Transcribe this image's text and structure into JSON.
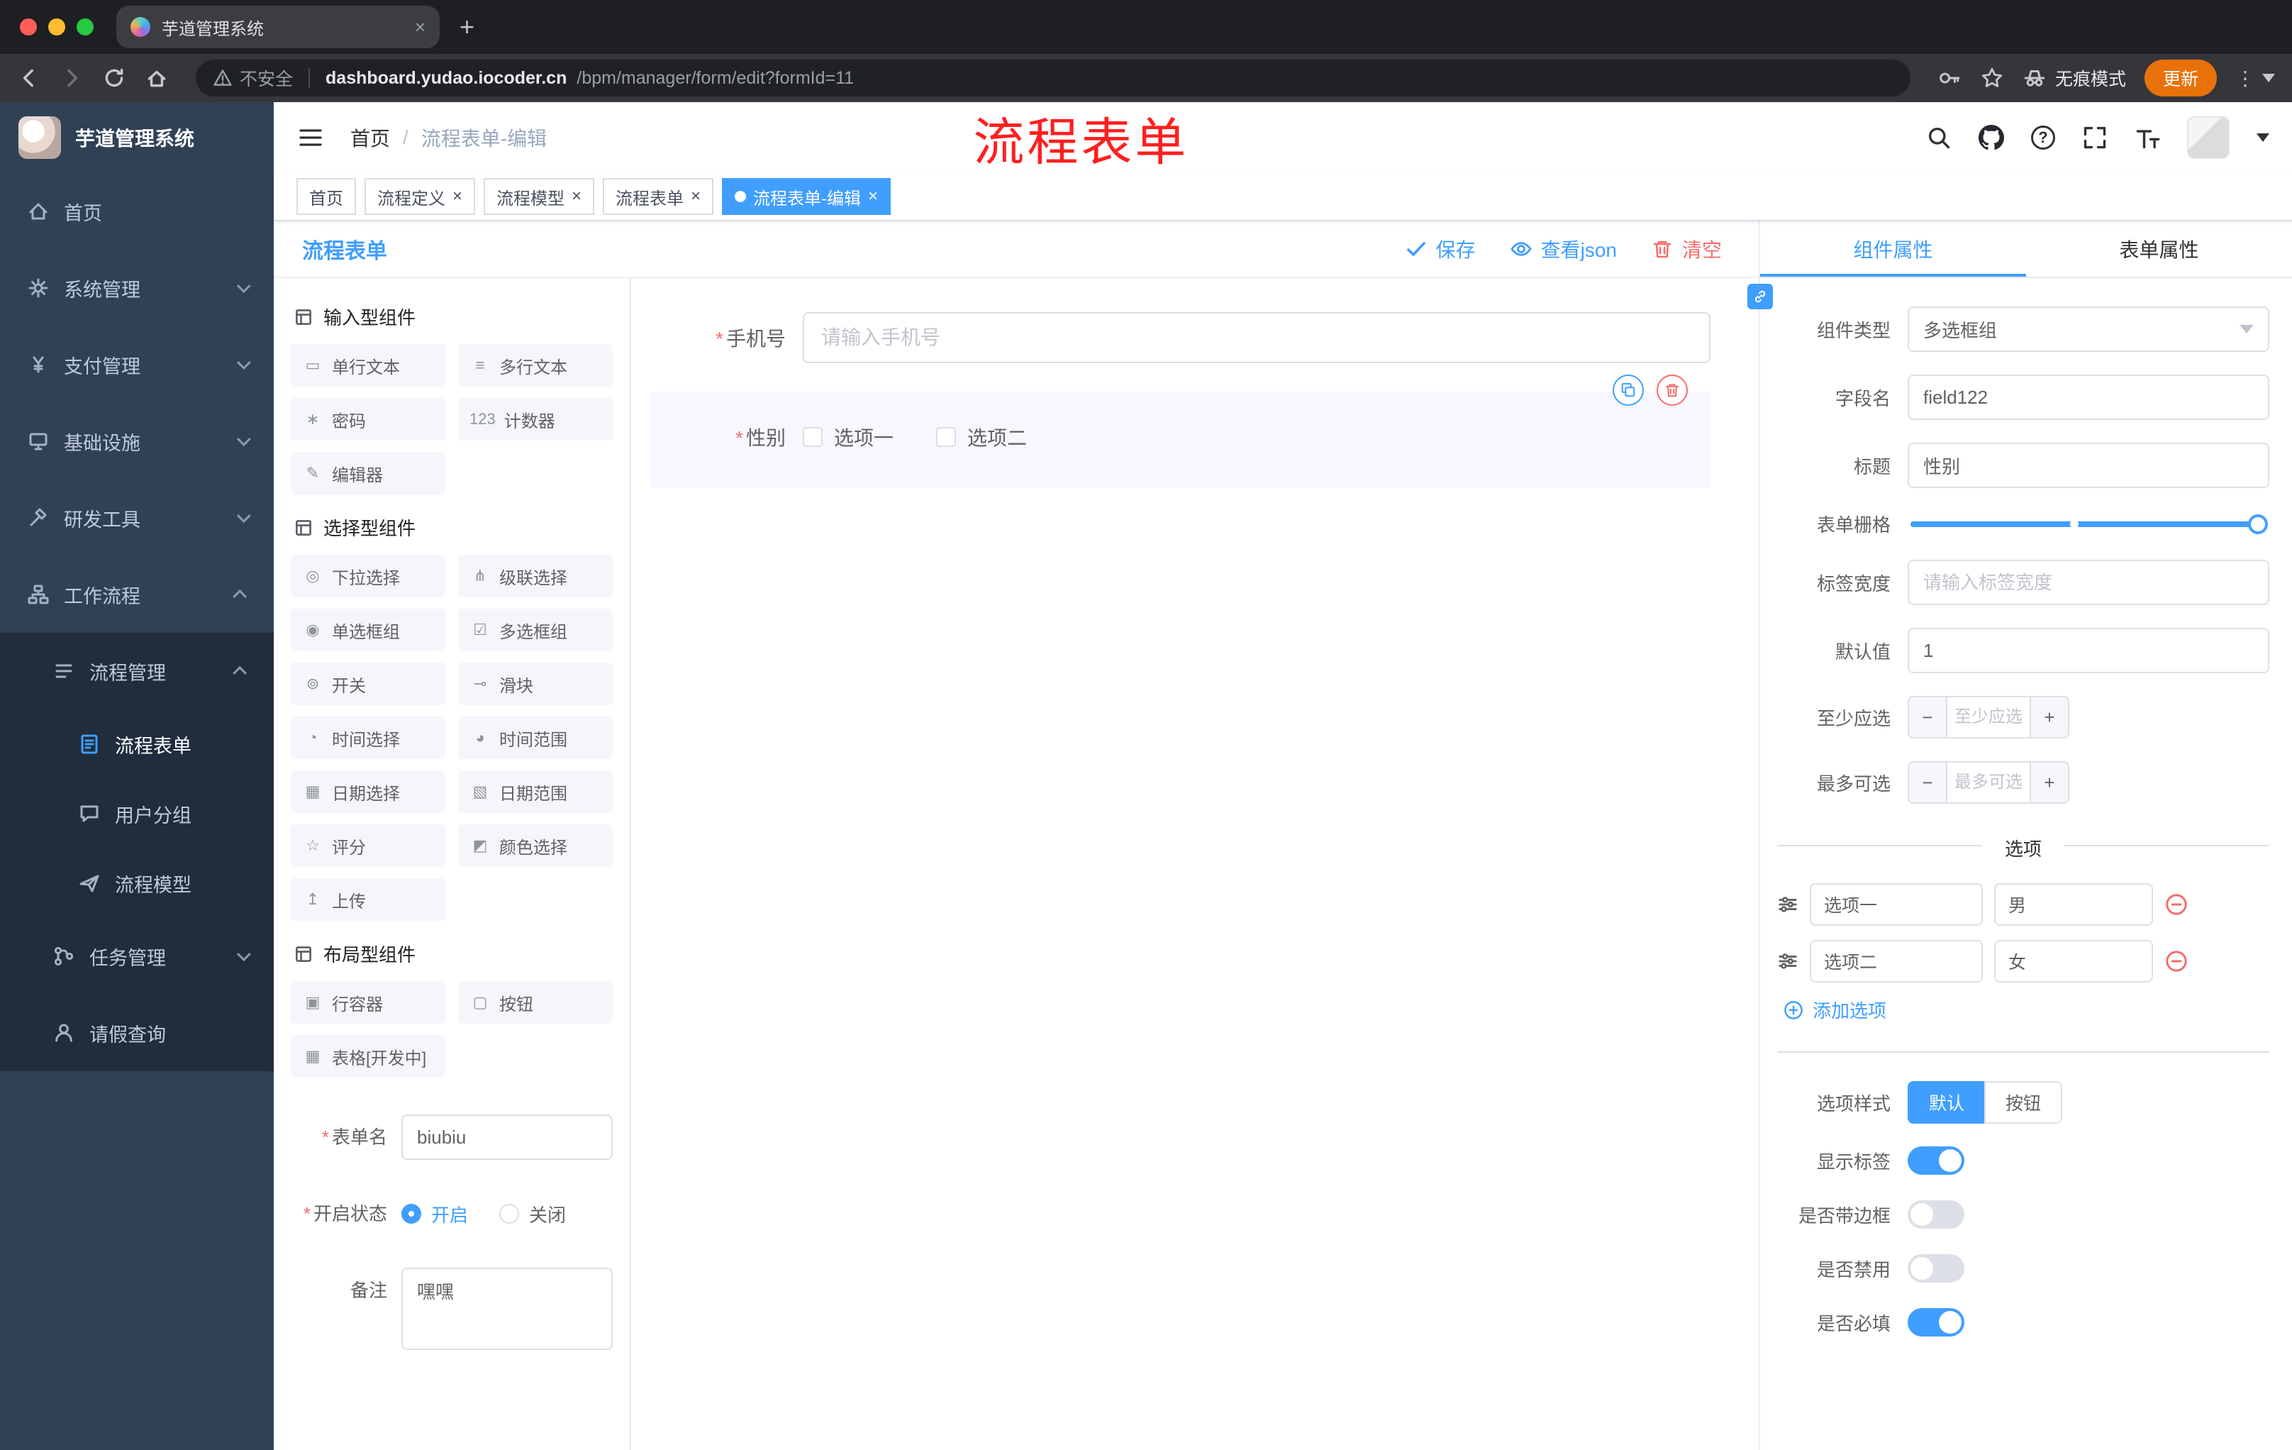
{
  "colors": {
    "accent": "#409eff",
    "danger": "#f56c6c",
    "sidebar_bg": "#304156",
    "submenu_bg": "#1f2d3d",
    "tag_active": "#409eff",
    "update_button": "#e8710a",
    "annotation": "#ff1f1f"
  },
  "browser": {
    "tab_title": "芋道管理系统",
    "security_label": "不安全",
    "url_host": "dashboard.yudao.iocoder.cn",
    "url_path": "/bpm/manager/form/edit?formId=11",
    "incognito_label": "无痕模式",
    "update_label": "更新"
  },
  "sidebar": {
    "logo_title": "芋道管理系统",
    "menu": [
      {
        "label": "首页"
      },
      {
        "label": "系统管理"
      },
      {
        "label": "支付管理"
      },
      {
        "label": "基础设施"
      },
      {
        "label": "研发工具"
      },
      {
        "label": "工作流程"
      },
      {
        "label": "流程管理"
      },
      {
        "label": "流程表单"
      },
      {
        "label": "用户分组"
      },
      {
        "label": "流程模型"
      },
      {
        "label": "任务管理"
      },
      {
        "label": "请假查询"
      }
    ]
  },
  "header": {
    "breadcrumb_home": "首页",
    "breadcrumb_sep": "/",
    "breadcrumb_current": "流程表单-编辑",
    "annotation": "流程表单"
  },
  "tags": [
    {
      "label": "首页"
    },
    {
      "label": "流程定义"
    },
    {
      "label": "流程模型"
    },
    {
      "label": "流程表单"
    },
    {
      "label": "流程表单-编辑"
    }
  ],
  "board": {
    "title": "流程表单",
    "save_label": "保存",
    "view_json_label": "查看json",
    "clear_label": "清空"
  },
  "components": {
    "sections": [
      {
        "title": "输入型组件",
        "items": [
          {
            "icon": "▭",
            "label": "单行文本"
          },
          {
            "icon": "≡",
            "label": "多行文本"
          },
          {
            "icon": "∗",
            "label": "密码"
          },
          {
            "icon": "123",
            "label": "计数器"
          },
          {
            "icon": "✎",
            "label": "编辑器"
          }
        ]
      },
      {
        "title": "选择型组件",
        "items": [
          {
            "icon": "◎",
            "label": "下拉选择"
          },
          {
            "icon": "⋔",
            "label": "级联选择"
          },
          {
            "icon": "◉",
            "label": "单选框组"
          },
          {
            "icon": "☑",
            "label": "多选框组"
          },
          {
            "icon": "⊚",
            "label": "开关"
          },
          {
            "icon": "⊸",
            "label": "滑块"
          },
          {
            "icon": "◔",
            "label": "时间选择"
          },
          {
            "icon": "◕",
            "label": "时间范围"
          },
          {
            "icon": "▦",
            "label": "日期选择"
          },
          {
            "icon": "▧",
            "label": "日期范围"
          },
          {
            "icon": "☆",
            "label": "评分"
          },
          {
            "icon": "◩",
            "label": "颜色选择"
          },
          {
            "icon": "↥",
            "label": "上传"
          }
        ]
      },
      {
        "title": "布局型组件",
        "items": [
          {
            "icon": "▣",
            "label": "行容器"
          },
          {
            "icon": "▢",
            "label": "按钮"
          },
          {
            "icon": "▦",
            "label": "表格[开发中]"
          }
        ]
      }
    ]
  },
  "meta": {
    "form_name_label": "表单名",
    "form_name_value": "biubiu",
    "status_label": "开启状态",
    "status_on": "开启",
    "status_off": "关闭",
    "remark_label": "备注",
    "remark_value": "嘿嘿"
  },
  "canvas": {
    "phone_label": "手机号",
    "phone_placeholder": "请输入手机号",
    "gender_label": "性别",
    "gender_options": [
      "选项一",
      "选项二"
    ]
  },
  "props": {
    "tab_component": "组件属性",
    "tab_form": "表单属性",
    "type_label": "组件类型",
    "type_value": "多选框组",
    "field_label": "字段名",
    "field_value": "field122",
    "title_label": "标题",
    "title_value": "性别",
    "grid_label": "表单栅格",
    "label_width_label": "标签宽度",
    "label_width_placeholder": "请输入标签宽度",
    "default_label": "默认值",
    "default_value": "1",
    "min_label": "至少应选",
    "min_placeholder": "至少应选",
    "max_label": "最多可选",
    "max_placeholder": "最多可选",
    "options_divider": "选项",
    "options": [
      {
        "label": "选项一",
        "value": "男"
      },
      {
        "label": "选项二",
        "value": "女"
      }
    ],
    "add_option_label": "添加选项",
    "style_label": "选项样式",
    "style_options": [
      "默认",
      "按钮"
    ],
    "switch_rows": [
      {
        "label": "显示标签",
        "state": "on"
      },
      {
        "label": "是否带边框",
        "state": "off"
      },
      {
        "label": "是否禁用",
        "state": "off"
      },
      {
        "label": "是否必填",
        "state": "on"
      }
    ]
  }
}
